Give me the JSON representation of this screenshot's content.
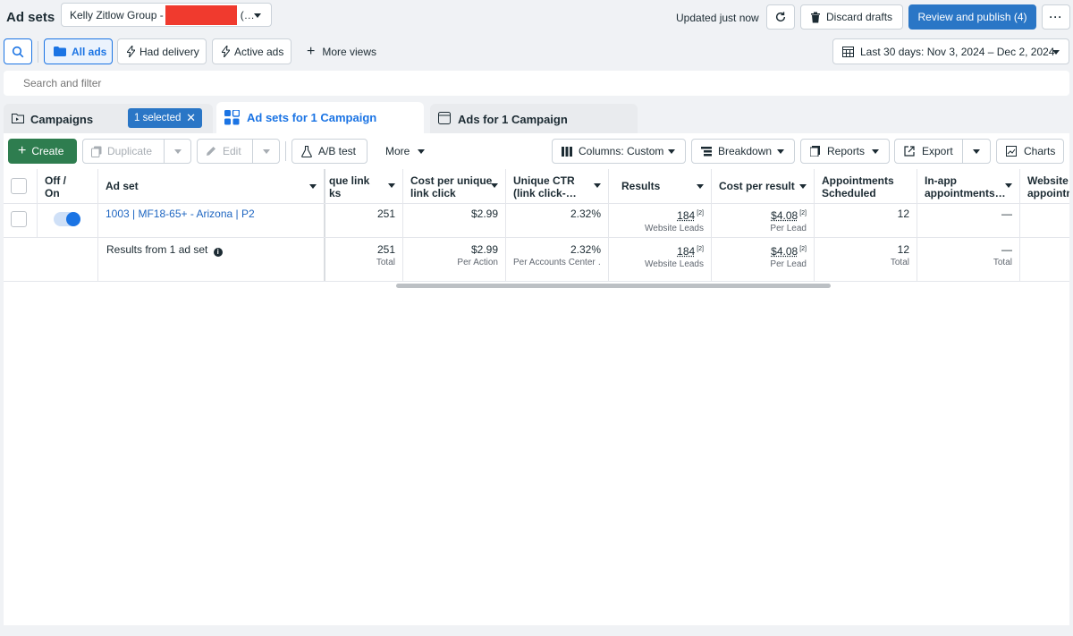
{
  "header": {
    "page_title": "Ad sets",
    "account": "Kelly Zitlow Group -",
    "account_suffix": "(…",
    "status": "Updated just now",
    "discard_label": "Discard drafts",
    "publish_label": "Review and publish (4)"
  },
  "viewbar": {
    "all_ads": "All ads",
    "had_delivery": "Had delivery",
    "active_ads": "Active ads",
    "more_views": "More views",
    "date_range": "Last 30 days: Nov 3, 2024 – Dec 2, 2024"
  },
  "search": {
    "placeholder": "Search and filter"
  },
  "tabs": {
    "campaigns": "Campaigns",
    "selected": "1 selected",
    "adsets": "Ad sets for 1 Campaign",
    "ads": "Ads for 1 Campaign"
  },
  "toolbar": {
    "create": "Create",
    "duplicate": "Duplicate",
    "edit": "Edit",
    "ab_test": "A/B test",
    "more": "More",
    "columns": "Columns: Custom",
    "breakdown": "Breakdown",
    "reports": "Reports",
    "export": "Export",
    "charts": "Charts"
  },
  "table": {
    "headers": {
      "offon_1": "Off /",
      "offon_2": "On",
      "adset": "Ad set",
      "unique_link_1": "que link",
      "unique_link_2": "ks",
      "cpu_1": "Cost per unique",
      "cpu_2": "link click",
      "ctr_1": "Unique CTR",
      "ctr_2": "(link click-…",
      "results": "Results",
      "cpr": "Cost per result",
      "appt_1": "Appointments",
      "appt_2": "Scheduled",
      "inapp_1": "In-app",
      "inapp_2": "appointments…",
      "web_1": "Website",
      "web_2": "appointn"
    },
    "row": {
      "name": "1003 | MF18-65+ - Arizona | P2",
      "unique_link": "251",
      "cpu": "$2.99",
      "ctr": "2.32%",
      "results": "184",
      "results_sup": "[2]",
      "results_sub": "Website Leads",
      "cpr": "$4.08",
      "cpr_sup": "[2]",
      "cpr_sub": "Per Lead",
      "appt": "12",
      "inapp": "—"
    },
    "summary": {
      "label": "Results from 1 ad set",
      "unique_link": "251",
      "unique_link_sub": "Total",
      "cpu": "$2.99",
      "cpu_sub": "Per Action",
      "ctr": "2.32%",
      "ctr_sub": "Per Accounts Center …",
      "results": "184",
      "results_sup": "[2]",
      "results_sub": "Website Leads",
      "cpr": "$4.08",
      "cpr_sup": "[2]",
      "cpr_sub": "Per Lead",
      "appt": "12",
      "appt_sub": "Total",
      "inapp": "—",
      "inapp_sub": "Total"
    }
  },
  "colors": {
    "primary": "#1b74e4",
    "publish": "#2a76c6",
    "create": "#2e7d4f",
    "redaction": "#f03a2e",
    "link": "#1d65c1"
  }
}
